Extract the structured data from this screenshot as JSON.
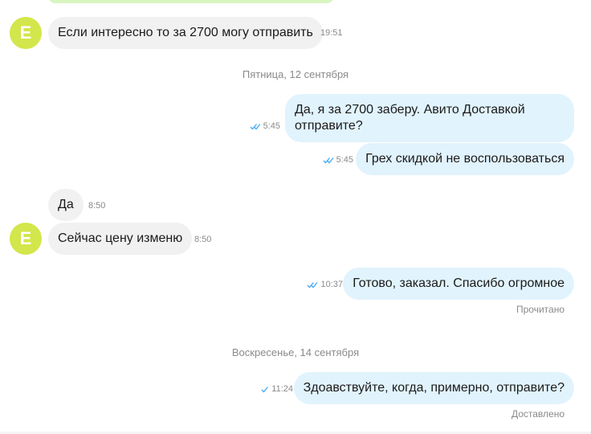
{
  "chat": {
    "avatar_letter": "E",
    "messages": [
      {
        "text": "Если интересно то за 2700 могу отправить",
        "time": "19:51"
      },
      {
        "text": "Да, я за 2700 заберу. Авито Доставкой отправите?",
        "time": "5:45"
      },
      {
        "text": "Грех скидкой не воспользоваться",
        "time": "5:45"
      },
      {
        "text": "Да",
        "time": "8:50"
      },
      {
        "text": "Сейчас цену изменю",
        "time": "8:50"
      },
      {
        "text": "Готово, заказал. Спасибо огромное",
        "time": "10:37"
      },
      {
        "text": "Здоавствуйте, когда, примерно, отправите?",
        "time": "11:24"
      }
    ],
    "date_separators": [
      "Пятница, 12 сентября",
      "Воскресенье, 14 сентября"
    ],
    "statuses": {
      "read": "Прочитано",
      "delivered": "Доставлено"
    }
  },
  "colors": {
    "avatar": "#d3e64b",
    "incoming_bubble": "#f1f1f1",
    "outgoing_bubble": "#e1f3fd",
    "check": "#3fa9f5"
  },
  "icons": {
    "read": "double-check-icon",
    "delivered": "single-check-icon"
  }
}
